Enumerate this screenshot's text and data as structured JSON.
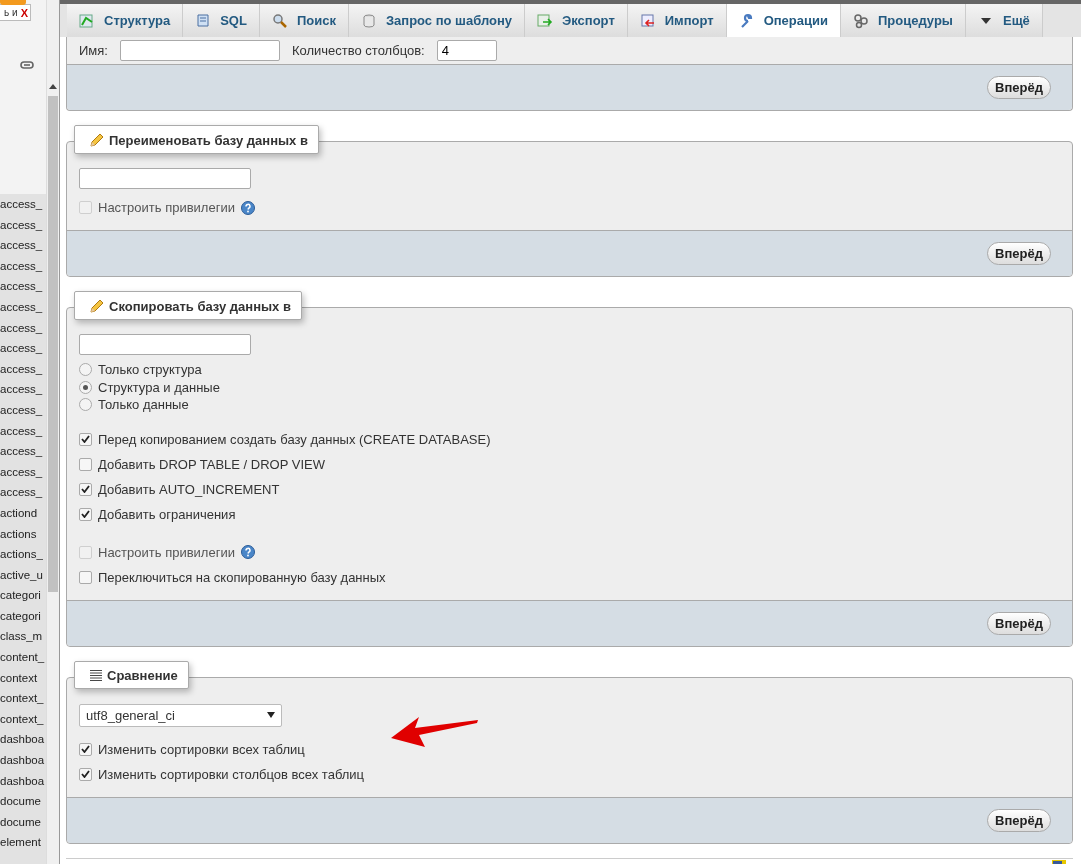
{
  "sidebar": {
    "filter": {
      "value": "ь и",
      "clear": "X"
    },
    "items": [
      "access_",
      "access_",
      "access_",
      "access_",
      "access_",
      "access_",
      "access_",
      "access_",
      "access_",
      "access_",
      "access_",
      "access_",
      "access_",
      "access_",
      "access_",
      "actiond",
      "actions",
      "actions_",
      "active_u",
      "categori",
      "categori",
      "class_m",
      "content_",
      "context",
      "context_",
      "context_",
      "dashboa",
      "dashboa",
      "dashboa",
      "docume",
      "docume",
      "element"
    ]
  },
  "tabs": [
    {
      "kind": "structure",
      "label": "Структура",
      "selected": false
    },
    {
      "kind": "sql",
      "label": "SQL",
      "selected": false
    },
    {
      "kind": "search",
      "label": "Поиск",
      "selected": false
    },
    {
      "kind": "query",
      "label": "Запрос по шаблону",
      "selected": false
    },
    {
      "kind": "export",
      "label": "Экспорт",
      "selected": false
    },
    {
      "kind": "import",
      "label": "Импорт",
      "selected": false
    },
    {
      "kind": "operations",
      "label": "Операции",
      "selected": true
    },
    {
      "kind": "routines",
      "label": "Процедуры",
      "selected": false
    },
    {
      "kind": "more",
      "label": "Ещё",
      "selected": false
    }
  ],
  "sections": [
    {
      "kind": "table",
      "fields": [
        {
          "label": "Имя:"
        },
        {
          "label": "Количество столбцов:",
          "value": "4"
        }
      ],
      "submit": "Вперёд"
    },
    {
      "kind": "rename",
      "legend": "Переименовать базу данных в",
      "groups": [
        [
          {
            "kind": "checkbox",
            "label": "Настроить привилегии",
            "checked": false,
            "disabled": true,
            "help": true
          }
        ]
      ],
      "submit": "Вперёд"
    },
    {
      "kind": "copy",
      "legend": "Скопировать базу данных в",
      "groups": [
        [
          {
            "kind": "radio",
            "label": "Только структура",
            "selected": false,
            "disabled": false,
            "help": false
          },
          {
            "kind": "radio",
            "label": "Структура и данные",
            "selected": true,
            "disabled": false,
            "help": false
          },
          {
            "kind": "radio",
            "label": "Только данные",
            "selected": false,
            "disabled": false,
            "help": false
          }
        ],
        [
          {
            "kind": "checkbox",
            "label": "Перед копированием создать базу данных (CREATE DATABASE)",
            "checked": true,
            "disabled": false,
            "help": false
          },
          {
            "kind": "checkbox",
            "label": "Добавить DROP TABLE / DROP VIEW",
            "checked": false,
            "disabled": false,
            "help": false
          },
          {
            "kind": "checkbox",
            "label": "Добавить AUTO_INCREMENT",
            "checked": true,
            "disabled": false,
            "help": false
          },
          {
            "kind": "checkbox",
            "label": "Добавить ограничения",
            "checked": true,
            "disabled": false,
            "help": false
          }
        ],
        [
          {
            "kind": "checkbox",
            "label": "Настроить привилегии",
            "checked": false,
            "disabled": true,
            "help": true
          },
          {
            "kind": "checkbox",
            "label": "Переключиться на скопированную базу данных",
            "checked": false,
            "disabled": false,
            "help": false
          }
        ]
      ],
      "submit": "Вперёд"
    },
    {
      "kind": "collation",
      "legend": "Сравнение",
      "select": "utf8_general_ci",
      "groups": [
        [
          {
            "kind": "checkbox",
            "label": "Изменить сортировки всех таблиц",
            "checked": true,
            "disabled": false,
            "help": false
          },
          {
            "kind": "checkbox",
            "label": "Изменить сортировки столбцов всех таблиц",
            "checked": true,
            "disabled": false,
            "help": false
          }
        ]
      ],
      "submit": "Вперёд"
    }
  ]
}
